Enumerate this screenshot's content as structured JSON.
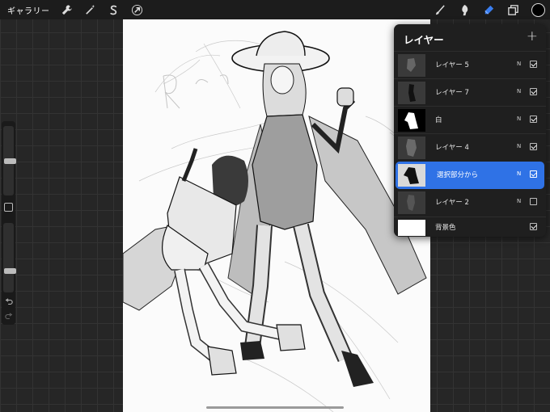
{
  "topbar": {
    "gallery_label": "ギャラリー",
    "left_tools": [
      "wrench-icon",
      "magic-wand-icon",
      "selection-s-icon",
      "transform-arrow-icon"
    ],
    "right_tools": [
      "brush-icon",
      "smudge-icon",
      "eraser-icon",
      "layers-icon"
    ],
    "active_tool": "eraser-icon",
    "active_color": "#000000",
    "accent": "#3a7ef0"
  },
  "sidebar": {
    "brush_size_fraction": 0.6,
    "opacity_fraction": 0.55,
    "icons": [
      "modify-square-icon",
      "undo-icon",
      "redo-icon"
    ]
  },
  "layers_panel": {
    "title": "レイヤー",
    "add_label": "+",
    "layers": [
      {
        "name": "レイヤー 5",
        "blend": "N",
        "visible": true,
        "selected": false
      },
      {
        "name": "レイヤー 7",
        "blend": "N",
        "visible": true,
        "selected": false
      },
      {
        "name": "白",
        "blend": "N",
        "visible": true,
        "selected": false
      },
      {
        "name": "レイヤー 4",
        "blend": "N",
        "visible": true,
        "selected": false
      },
      {
        "name": "選択部分から",
        "blend": "N",
        "visible": true,
        "selected": true
      },
      {
        "name": "レイヤー 2",
        "blend": "N",
        "visible": false,
        "selected": false
      },
      {
        "name": "背景色",
        "blend": "",
        "visible": true,
        "selected": false
      }
    ]
  },
  "canvas": {
    "background": "#fbfbfb"
  }
}
